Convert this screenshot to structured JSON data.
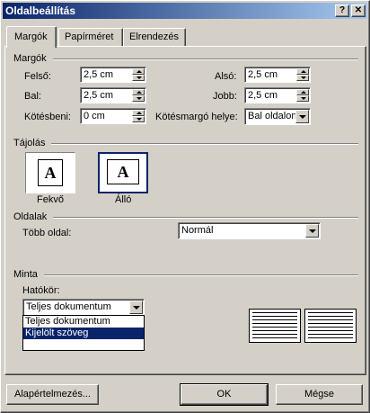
{
  "window": {
    "title": "Oldalbeállítás",
    "help_label": "?",
    "close_label": "✕"
  },
  "tabs": [
    {
      "label": "Margók"
    },
    {
      "label": "Papírméret"
    },
    {
      "label": "Elrendezés"
    }
  ],
  "margins": {
    "section_label": "Margók",
    "top_label": "Felső:",
    "top_value": "2,5 cm",
    "bottom_label": "Alsó:",
    "bottom_value": "2,5 cm",
    "left_label": "Bal:",
    "left_value": "2,5 cm",
    "right_label": "Jobb:",
    "right_value": "2,5 cm",
    "gutter_label": "Kötésbeni:",
    "gutter_value": "0 cm",
    "gutter_pos_label": "Kötésmargó helye:",
    "gutter_pos_value": "Bal oldalon"
  },
  "orientation": {
    "section_label": "Tájolás",
    "landscape_label": "Fekvő",
    "portrait_label": "Álló",
    "icon_glyph": "A"
  },
  "pages": {
    "section_label": "Oldalak",
    "multiple_label": "Több oldal:",
    "multiple_value": "Normál"
  },
  "preview": {
    "section_label": "Minta",
    "apply_label": "Hatókör:",
    "apply_value": "Teljes dokumentum",
    "apply_options": [
      "Teljes dokumentum",
      "Kijelölt szöveg"
    ]
  },
  "buttons": {
    "default_label": "Alapértelmezés...",
    "ok_label": "OK",
    "cancel_label": "Mégse"
  }
}
